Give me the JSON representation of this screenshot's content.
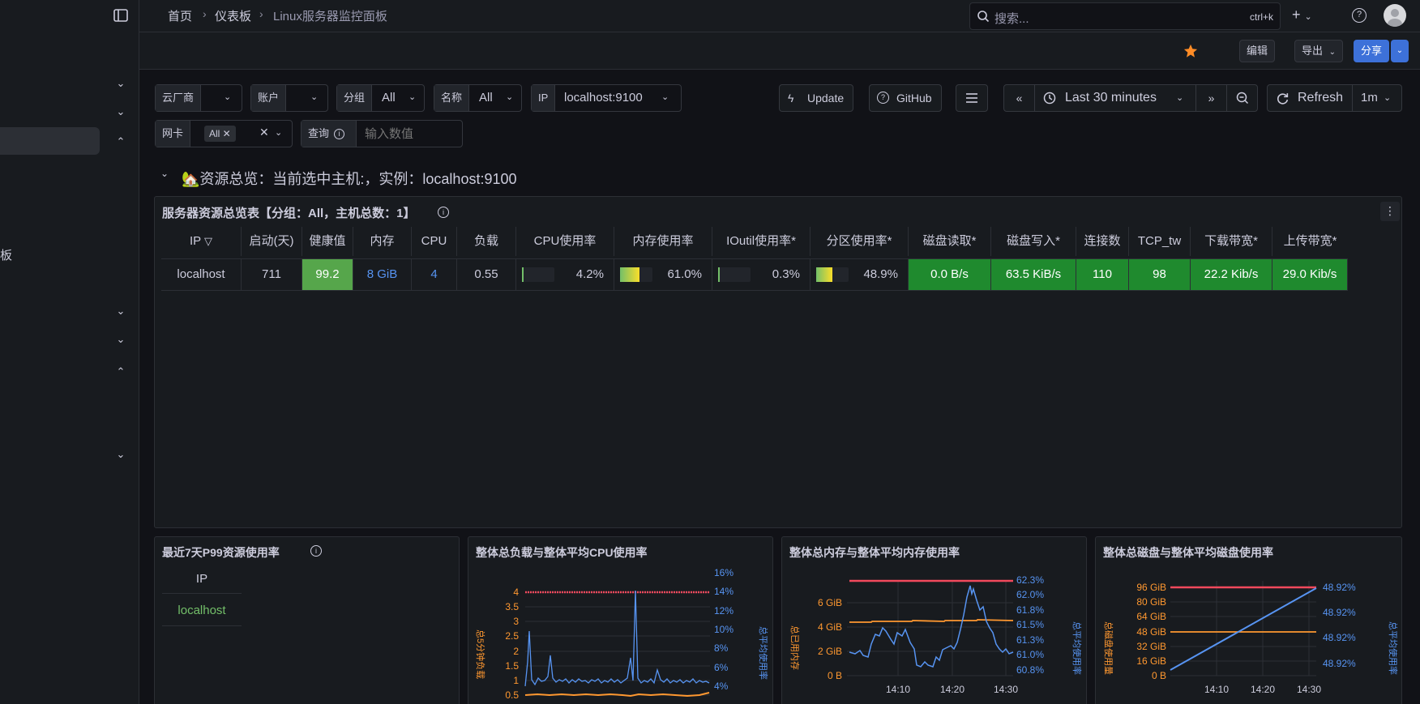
{
  "breadcrumbs": [
    "首页",
    "仪表板",
    "Linux服务器监控面板"
  ],
  "search": {
    "placeholder": "搜索...",
    "shortcut": "ctrl+k"
  },
  "toolbar": {
    "edit": "编辑",
    "export": "导出",
    "share": "分享"
  },
  "sidebar": {
    "partial_text": "板"
  },
  "variables": [
    {
      "label": "云厂商",
      "value": ""
    },
    {
      "label": "账户",
      "value": ""
    },
    {
      "label": "分组",
      "value": "All"
    },
    {
      "label": "名称",
      "value": "All"
    },
    {
      "label": "IP",
      "value": "localhost:9100"
    },
    {
      "label": "网卡",
      "value": "All"
    },
    {
      "label": "查询",
      "placeholder": "输入数值"
    }
  ],
  "controls": {
    "update": "Update",
    "github": "GitHub",
    "time_range": "Last 30 minutes",
    "refresh": "Refresh",
    "refresh_interval": "1m"
  },
  "row_title": "🏡资源总览：当前选中主机:，实例：localhost:9100",
  "overview_panel": {
    "title": "服务器资源总览表【分组：All，主机总数：1】",
    "headers": [
      "IP",
      "启动(天)",
      "健康值",
      "内存",
      "CPU",
      "负载",
      "CPU使用率",
      "内存使用率",
      "IOutil使用率*",
      "分区使用率*",
      "磁盘读取*",
      "磁盘写入*",
      "连接数",
      "TCP_tw",
      "下载带宽*",
      "上传带宽*"
    ],
    "row": [
      "localhost",
      "711",
      "99.2",
      "8 GiB",
      "4",
      "0.55",
      "4.2%",
      "61.0%",
      "0.3%",
      "48.9%",
      "0.0 B/s",
      "63.5 KiB/s",
      "110",
      "98",
      "22.2 Kib/s",
      "29.0 Kib/s"
    ],
    "gauges": {
      "cpu": 0.042,
      "mem": 0.61,
      "ioutil": 0.003,
      "partition": 0.489
    }
  },
  "p99_panel": {
    "title": "最近7天P99资源使用率",
    "header": "IP",
    "value": "localhost"
  },
  "charts": {
    "load": {
      "title": "整体总负载与整体平均CPU使用率",
      "left_label": "总5分钟负载",
      "right_label": "总平均使用率",
      "left_ticks": [
        "4",
        "3.5",
        "3",
        "2.5",
        "2",
        "1.5",
        "1",
        "0.5"
      ],
      "right_ticks": [
        "16%",
        "14%",
        "12%",
        "10%",
        "8%",
        "6%",
        "4%"
      ]
    },
    "memory": {
      "title": "整体总内存与整体平均内存使用率",
      "left_label": "总已用内存",
      "right_label": "总平均使用率",
      "left_ticks": [
        "6 GiB",
        "4 GiB",
        "2 GiB",
        "0 B"
      ],
      "right_ticks": [
        "62.3%",
        "62.0%",
        "61.8%",
        "61.5%",
        "61.3%",
        "61.0%",
        "60.8%"
      ],
      "x_ticks": [
        "14:10",
        "14:20",
        "14:30"
      ]
    },
    "disk": {
      "title": "整体总磁盘与整体平均磁盘使用率",
      "left_label": "总磁盘使用量",
      "right_label": "总平均使用率",
      "left_ticks": [
        "96 GiB",
        "80 GiB",
        "64 GiB",
        "48 GiB",
        "32 GiB",
        "16 GiB",
        "0 B"
      ],
      "right_ticks": [
        "48.92%",
        "48.92%",
        "48.92%",
        "48.92%"
      ],
      "x_ticks": [
        "14:10",
        "14:20",
        "14:30"
      ]
    }
  },
  "colors": {
    "accent": "#3d71d9",
    "good": "#1f8a2e",
    "orange": "#ff9830",
    "red": "#f2495c",
    "blue": "#5794f2"
  }
}
